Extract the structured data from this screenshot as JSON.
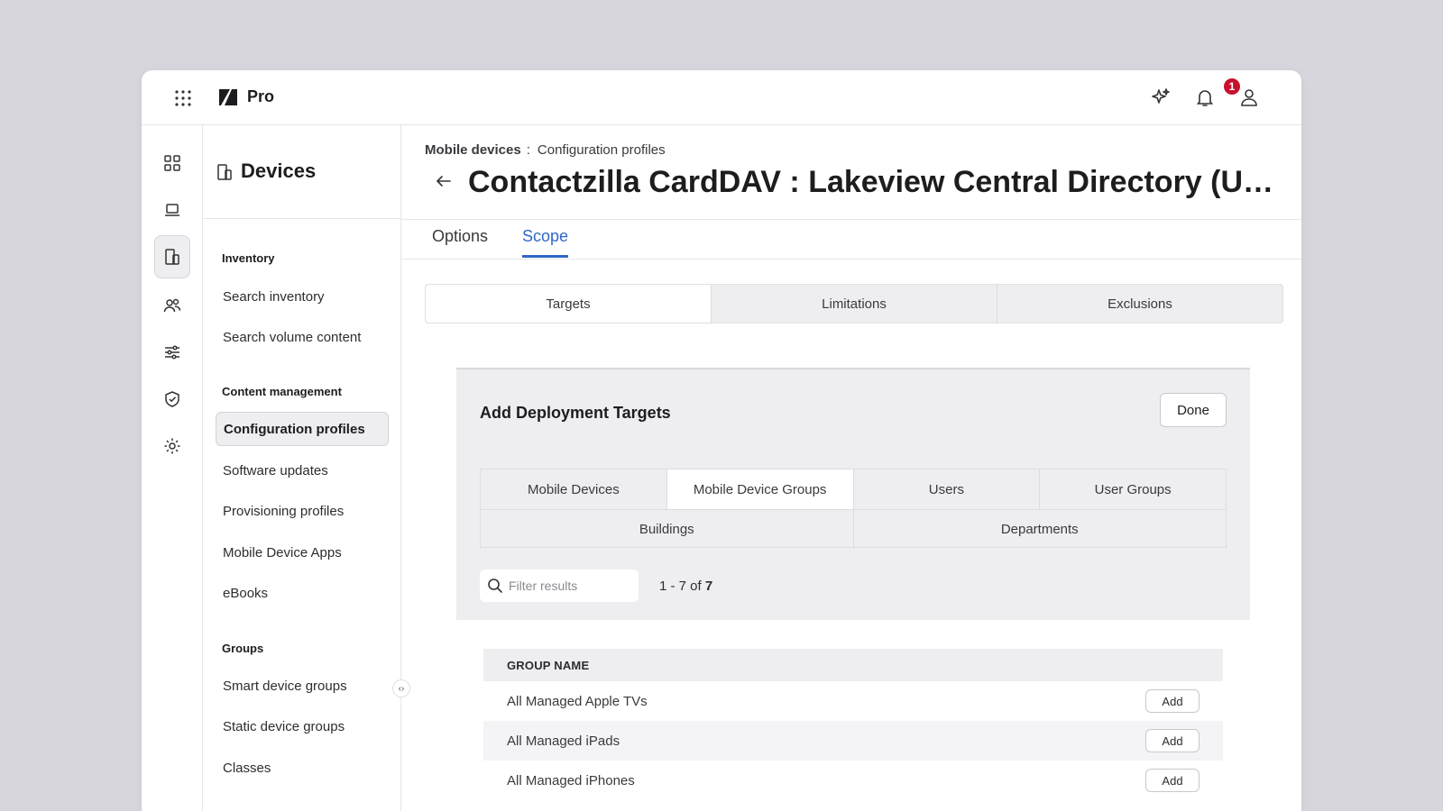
{
  "app": {
    "brand": "Pro",
    "notification_count": "1"
  },
  "sidenav": {
    "title": "Devices",
    "sections": [
      {
        "label": "Inventory",
        "items": [
          "Search inventory",
          "Search volume content"
        ]
      },
      {
        "label": "Content management",
        "items": [
          "Configuration profiles",
          "Software updates",
          "Provisioning profiles",
          "Mobile Device Apps",
          "eBooks"
        ]
      },
      {
        "label": "Groups",
        "items": [
          "Smart device groups",
          "Static device groups",
          "Classes"
        ]
      }
    ],
    "active_item": "Configuration profiles",
    "collapse_glyph": "‹›"
  },
  "breadcrumb": {
    "parent": "Mobile devices",
    "separator": ":",
    "current": "Configuration profiles"
  },
  "page_title": "Contactzilla CardDAV : Lakeview Central Directory (Unmanaged)",
  "tabs": [
    {
      "label": "Options",
      "active": false
    },
    {
      "label": "Scope",
      "active": true
    }
  ],
  "scope_tabs": [
    {
      "label": "Targets",
      "active": true
    },
    {
      "label": "Limitations",
      "active": false
    },
    {
      "label": "Exclusions",
      "active": false
    }
  ],
  "panel": {
    "title": "Add Deployment Targets",
    "done_label": "Done",
    "target_types_row1": [
      {
        "label": "Mobile Devices",
        "active": false
      },
      {
        "label": "Mobile Device Groups",
        "active": true
      },
      {
        "label": "Users",
        "active": false
      },
      {
        "label": "User Groups",
        "active": false
      }
    ],
    "target_types_row2": [
      {
        "label": "Buildings",
        "active": false
      },
      {
        "label": "Departments",
        "active": false
      }
    ],
    "filter_placeholder": "Filter results",
    "count_prefix": "1 - 7 of ",
    "count_total": "7"
  },
  "table": {
    "header": "GROUP NAME",
    "add_label": "Add",
    "rows": [
      "All Managed Apple TVs",
      "All Managed iPads",
      "All Managed iPhones"
    ]
  },
  "colors": {
    "accent": "#2f66c9",
    "badge": "#c8102e"
  }
}
